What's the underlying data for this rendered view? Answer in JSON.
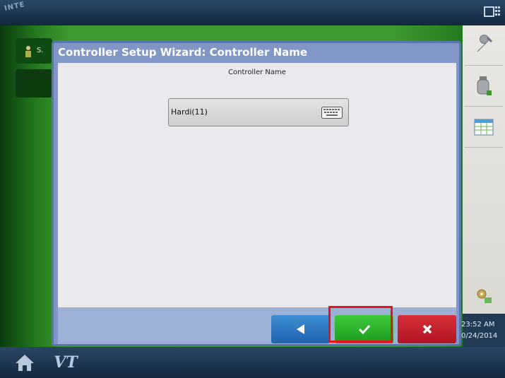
{
  "top_bar": {
    "brand_text": "INTE",
    "icon": "display-grid-icon"
  },
  "background_tiles": {
    "operator_initial": "S."
  },
  "dialog": {
    "title": "Controller Setup Wizard:  Controller Name",
    "field_label": "Controller Name",
    "field_value": "Hardi(11)",
    "keyboard_icon": "keyboard-icon",
    "buttons": {
      "back_icon": "arrow-left-icon",
      "ok_icon": "checkmark-icon",
      "cancel_icon": "x-icon"
    }
  },
  "right_bar": {
    "items": [
      "wrench-icon",
      "tank-icon",
      "spreadsheet-icon",
      "field-gear-icon"
    ],
    "time": "23:52 AM",
    "date": "0/24/2014"
  },
  "bottom_bar": {
    "home_icon": "home-icon",
    "vt_label": "VT"
  },
  "colors": {
    "title_bar": "#7f96c6",
    "back_button": "#2a78c4",
    "ok_button": "#2ab52a",
    "cancel_button": "#c8202c",
    "highlight": "#e8141c"
  }
}
